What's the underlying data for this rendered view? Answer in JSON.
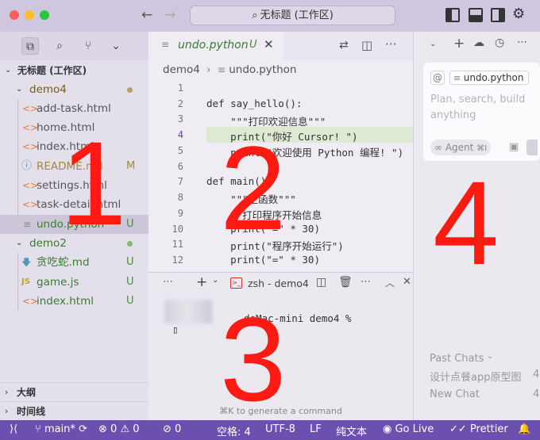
{
  "window": {
    "title": "无标题 (工作区)",
    "back_label": "←",
    "forward_label": "→"
  },
  "sidebar": {
    "workspace_label": "无标题 (工作区)",
    "folders": [
      {
        "name": "demo4",
        "files": [
          {
            "name": "add-task.html",
            "icon": "html-icon",
            "badge": ""
          },
          {
            "name": "home.html",
            "icon": "html-icon",
            "badge": ""
          },
          {
            "name": "index.html",
            "icon": "html-icon",
            "badge": ""
          },
          {
            "name": "README.md",
            "icon": "info-icon",
            "badge": "M"
          },
          {
            "name": "settings.html",
            "icon": "html-icon",
            "badge": ""
          },
          {
            "name": "task-detail.html",
            "icon": "html-icon",
            "badge": ""
          },
          {
            "name": "undo.python",
            "icon": "file-lines-icon",
            "badge": "U"
          }
        ]
      },
      {
        "name": "demo2",
        "files": [
          {
            "name": "贪吃蛇.md",
            "icon": "markdown-icon",
            "badge": "U"
          },
          {
            "name": "game.js",
            "icon": "js-icon",
            "badge": "U"
          },
          {
            "name": "index.html",
            "icon": "html-icon",
            "badge": "U"
          }
        ]
      }
    ],
    "outline_label": "大纲",
    "timeline_label": "时间线"
  },
  "editor": {
    "tab_label": "undo.python",
    "tab_badge": "U",
    "breadcrumb": [
      "demo4",
      "undo.python"
    ],
    "line_numbers": [
      "1",
      "2",
      "3",
      "4",
      "5",
      "6",
      "7",
      "8",
      "9",
      "10",
      "11",
      "12"
    ],
    "lines": [
      "",
      "def say_hello():",
      "    \"\"\"打印欢迎信息\"\"\"",
      "    print(\"你好 Cursor! \")",
      "    print(\"欢迎使用 Python 编程! \")",
      "",
      "def main():",
      "    \"\"\"主函数\"\"\"",
      "    # 打印程序开始信息",
      "    print(\"=\" * 30)",
      "    print(\"程序开始运行\")",
      "    print(\"=\" * 30)"
    ]
  },
  "terminal": {
    "tab_label": "zsh - demo4",
    "prompt": "deMac-mini demo4 %",
    "cursor": "▯",
    "hint": "⌘K to generate a command"
  },
  "chat": {
    "context_pill": "undo.python",
    "placeholder": "Plan, search, build anything",
    "agent_label": "Agent",
    "agent_shortcut": "⌘I",
    "past_chats_label": "Past Chats",
    "past_chats": [
      {
        "title": "设计点餐app原型图",
        "time": "4"
      },
      {
        "title": "New Chat",
        "time": "4"
      }
    ]
  },
  "status_bar": {
    "branch": "main*",
    "errors": "0",
    "warnings": "0",
    "ports": "0",
    "indent": "空格: 4",
    "encoding": "UTF-8",
    "eol": "LF",
    "language": "纯文本",
    "go_live": "Go Live",
    "prettier": "Prettier"
  },
  "annotations": [
    "1",
    "2",
    "3",
    "4"
  ],
  "colors": {
    "accent_purple": "#6b50b0",
    "annotation_red": "#ff1a12",
    "html_orange": "#e37933",
    "js_yellow": "#cbcb41",
    "markdown_blue": "#519aba",
    "untracked_green": "#4a8a3d",
    "modified_olive": "#a08b3b"
  }
}
